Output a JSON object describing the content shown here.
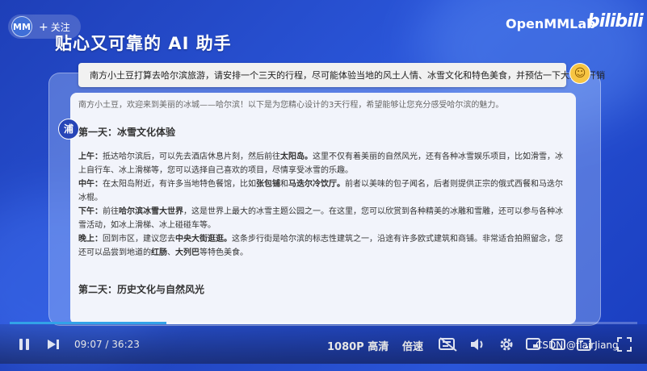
{
  "header": {
    "uploader_initials": "MM",
    "follow_label": "关注",
    "title": "贴心又可靠的 AI 助手",
    "brand": "OpenMMLab",
    "site_logo_text": "bilibili"
  },
  "chat": {
    "prompt": "南方小土豆打算去哈尔滨旅游，请安排一个三天的行程，尽可能体验当地的风土人情、冰雪文化和特色美食，并预估一下大致的开销",
    "bot_avatar": "浦",
    "intro": "南方小土豆，欢迎来到美丽的冰城——哈尔滨！以下是为您精心设计的3天行程，希望能够让您充分感受哈尔滨的魅力。",
    "day1_title": "第一天：冰雪文化体验",
    "morning_label": "上午：",
    "morning_text_a": "抵达哈尔滨后，可以先去酒店休息片刻，然后前往",
    "morning_bold": "太阳岛。",
    "morning_text_b": "这里不仅有着美丽的自然风光，还有各种冰雪娱乐项目，比如滑雪，冰上自行车、冰上滑梯等，您可以选择自己喜欢的项目，尽情享受冰雪的乐趣。",
    "noon_label": "中午：",
    "noon_text_a": "在太阳岛附近，有许多当地特色餐馆，比如",
    "noon_bold_a": "张包铺",
    "noon_text_b": "和",
    "noon_bold_b": "马迭尔冷饮厅。",
    "noon_text_c": "前者以美味的包子闻名，后者则提供正宗的俄式西餐和马迭尔冰棍。",
    "afternoon_label": "下午：",
    "afternoon_text_a": "前往",
    "afternoon_bold": "哈尔滨冰雪大世界",
    "afternoon_text_b": "，这是世界上最大的冰雪主题公园之一。在这里，您可以欣赏到各种精美的冰雕和雪雕，还可以参与各种冰雪活动，如冰上滑梯、冰上碰碰车等。",
    "evening_label": "晚上：",
    "evening_text_a": "回到市区，建议您去",
    "evening_bold": "中央大街逛逛。",
    "evening_text_b": "这条步行街是哈尔滨的标志性建筑之一，沿途有许多欧式建筑和商铺。非常适合拍照留念，您还可以品尝到地道的",
    "evening_bold_b": "红肠",
    "evening_text_c": "、",
    "evening_bold_c": "大列巴",
    "evening_text_d": "等特色美食。",
    "day2_title": "第二天：历史文化与自然风光"
  },
  "player": {
    "current_time": "09:07",
    "separator": "/",
    "total_time": "36:23",
    "progress": 0.25,
    "quality_label": "1080P 高清",
    "speed_label": "倍速",
    "watermark": "CSDN @flairJiang",
    "icons": [
      "pause-icon",
      "next-icon",
      "danmaku-off-icon",
      "volume-icon",
      "settings-icon",
      "pip-icon",
      "widescreen-icon",
      "web-fullscreen-icon",
      "fullscreen-icon"
    ]
  }
}
